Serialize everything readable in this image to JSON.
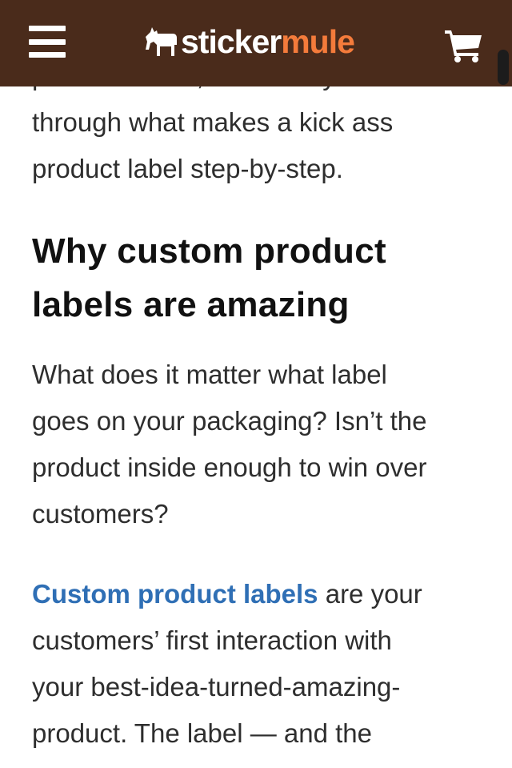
{
  "header": {
    "menu_icon": "hamburger-menu-icon",
    "logo": {
      "part1": "sticker",
      "part2": "mule",
      "mascot_icon": "mule-icon"
    },
    "cart_icon": "shopping-cart-icon",
    "colors": {
      "bar": "#4a2b1b",
      "accent": "#f47b3b"
    }
  },
  "article": {
    "cut_line": "product labels, and walk you",
    "intro_lines": [
      "through what makes a kick ass",
      "product label step-by-step."
    ],
    "heading_lines": [
      "Why custom product",
      "labels are amazing"
    ],
    "para1_lines": [
      "What does it matter what label",
      "goes on your packaging? Isn’t the",
      "product inside enough to win over",
      "customers?"
    ],
    "para2": {
      "link_text": "Custom product labels",
      "first_line_rest": " are your",
      "lines": [
        "customers’ first interaction with",
        "your best-idea-turned-amazing-",
        "product. The label — and the"
      ]
    },
    "link_color": "#2f6fb5"
  }
}
